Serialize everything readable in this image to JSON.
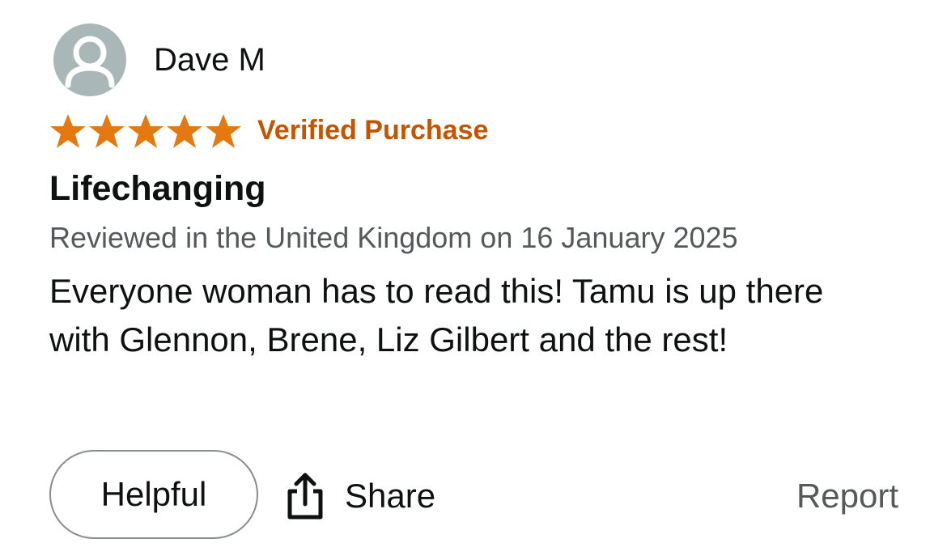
{
  "reviewer": {
    "name": "Dave M",
    "avatar_icon": "person-silhouette-icon"
  },
  "rating": {
    "stars": 5,
    "max_stars": 5,
    "star_color": "#e47911",
    "badge": "Verified Purchase",
    "badge_color": "#c45500"
  },
  "review": {
    "title": "Lifechanging",
    "meta": "Reviewed in the United Kingdom on 16 January 2025",
    "body": "Everyone woman has to read this! Tamu is up there with Glennon, Brene, Liz Gilbert and the rest!"
  },
  "actions": {
    "helpful_label": "Helpful",
    "share_label": "Share",
    "share_icon": "share-upload-icon",
    "report_label": "Report"
  }
}
